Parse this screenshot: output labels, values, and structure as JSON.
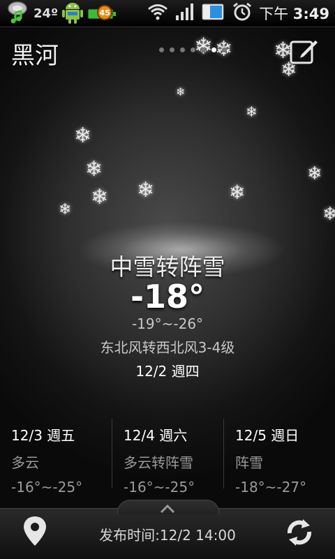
{
  "status_bar": {
    "temperature": "24º",
    "battery_level": "45",
    "time_prefix": "下午",
    "time": "3:49",
    "icons": [
      "weather-icon",
      "music-icon",
      "android-icon",
      "battery-icon",
      "wifi-icon",
      "signal-icon",
      "sim-icon",
      "alarm-icon"
    ]
  },
  "header": {
    "city": "黑河",
    "page_count": 7,
    "active_page": 5
  },
  "current": {
    "condition": "中雪转阵雪",
    "temperature": "-18°",
    "range": "-19°~-26°",
    "wind": "东北风转西北风3-4级",
    "date": "12/2 週四"
  },
  "forecast": [
    {
      "date": "12/3 週五",
      "condition": "多云",
      "temp": "-16°~-25°"
    },
    {
      "date": "12/4 週六",
      "condition": "多云转阵雪",
      "temp": "-16°~-25°"
    },
    {
      "date": "12/5 週日",
      "condition": "阵雪",
      "temp": "-18°~-27°"
    }
  ],
  "bottom_bar": {
    "publish_time": "发布时间:12/2 14:00"
  },
  "colors": {
    "accent_text": "#ffffff",
    "secondary_text": "#9a9a9a",
    "battery_green": "#3fb93a",
    "badge_orange": "#e88e1a"
  }
}
